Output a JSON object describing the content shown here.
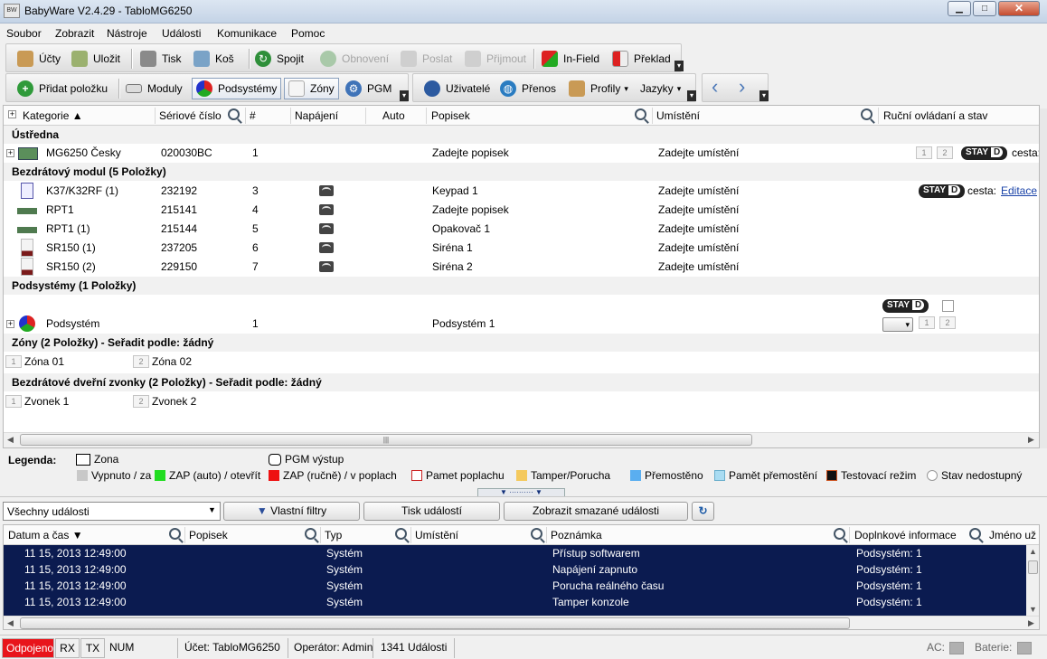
{
  "window": {
    "title": "BabyWare V2.4.29 - TabloMG6250",
    "app_icon_text": "BW",
    "minimize": "▁",
    "maximize": "□",
    "close": "✕"
  },
  "menu": [
    "Soubor",
    "Zobrazit",
    "Nástroje",
    "Události",
    "Komunikace",
    "Pomoc"
  ],
  "toolbar1": {
    "accounts": "Účty",
    "save": "Uložit",
    "print": "Tisk",
    "trash": "Koš",
    "connect": "Spojit",
    "refresh": "Obnovení",
    "send": "Poslat",
    "receive": "Přijmout",
    "infield": "In-Field",
    "translate": "Překlad"
  },
  "toolbar2": {
    "add_item": "Přidat položku",
    "modules": "Moduly",
    "subsystems": "Podsystémy",
    "zones": "Zóny",
    "pgm": "PGM",
    "users": "Uživatelé",
    "transfer": "Přenos",
    "profiles": "Profily",
    "languages": "Jazyky"
  },
  "grid": {
    "headers": {
      "category": "Kategorie",
      "serial": "Sériové číslo",
      "num": "#",
      "power": "Napájení",
      "auto": "Auto",
      "label": "Popisek",
      "location": "Umístění",
      "manual": "Ruční ovládaní a stav"
    },
    "groups": {
      "panel": "Ústředna",
      "wireless": "Bezdrátový modul (5 Položky)",
      "subsystems": "Podsystémy (1 Položky)",
      "zones": "Zóny  (2 Položky) - Seřadit podle: žádný",
      "doorbells": "Bezdrátové dveřní zvonky (2 Položky) - Seřadit podle: žádný"
    },
    "panel_row": {
      "name": "MG6250 Česky",
      "serial": "020030BC",
      "num": "1",
      "label": "Zadejte popisek",
      "location": "Zadejte umístění",
      "box1": "1",
      "box2": "2",
      "stay": "STAY",
      "stay_d": "D",
      "path": "cesta:"
    },
    "modules": [
      {
        "name": "K37/K32RF (1)",
        "serial": "232192",
        "num": "3",
        "label": "Keypad 1",
        "location": "Zadejte umístění"
      },
      {
        "name": "RPT1",
        "serial": "215141",
        "num": "4",
        "label": "Zadejte popisek",
        "location": "Zadejte umístění"
      },
      {
        "name": "RPT1 (1)",
        "serial": "215144",
        "num": "5",
        "label": "Opakovač 1",
        "location": "Zadejte umístění"
      },
      {
        "name": "SR150 (1)",
        "serial": "237205",
        "num": "6",
        "label": "Siréna 1",
        "location": "Zadejte umístění"
      },
      {
        "name": "SR150 (2)",
        "serial": "229150",
        "num": "7",
        "label": "Siréna 2",
        "location": "Zadejte umístění"
      }
    ],
    "keypad_extra": {
      "stay": "STAY",
      "stay_d": "D",
      "path": "cesta:",
      "edit": "Editace"
    },
    "subsystem_row": {
      "name": "Podsystém",
      "num": "1",
      "label": "Podsystém 1",
      "stay": "STAY",
      "stay_d": "D",
      "box1": "1",
      "box2": "2"
    },
    "zones": [
      {
        "num": "1",
        "name": "Zóna 01"
      },
      {
        "num": "2",
        "name": "Zóna 02"
      }
    ],
    "doorbells": [
      {
        "num": "1",
        "name": "Zvonek 1"
      },
      {
        "num": "2",
        "name": "Zvonek 2"
      }
    ],
    "hscroll_grip": "|||"
  },
  "legend": {
    "title": "Legenda:",
    "zone": "Zona",
    "pgm": "PGM výstup",
    "items": [
      {
        "label": "Vypnuto / za",
        "color": "#c8c8c8"
      },
      {
        "label": "ZAP (auto) / otevřít",
        "color": "#22dd22"
      },
      {
        "label": "ZAP (ručně) / v poplach",
        "color": "#ee1111"
      },
      {
        "label": "Pamet poplachu",
        "color": "#ffffff",
        "border": "#cc2222"
      },
      {
        "label": "Tamper/Porucha",
        "color": "#f4c95d"
      },
      {
        "label": "Přemostěno",
        "color": "#5aaef0"
      },
      {
        "label": "Pamět přemostění",
        "color": "#a9dcf2",
        "border": "#6aaecc"
      },
      {
        "label": "Testovací režim",
        "color": "#111111",
        "border": "#cc5522"
      },
      {
        "label": "Stav nedostupný",
        "color": "#ffffff",
        "border": "#999999"
      }
    ]
  },
  "events": {
    "filter_value": "Všechny události",
    "custom_filters": "Vlastní filtry",
    "print_events": "Tisk událostí",
    "show_deleted": "Zobrazit smazané události",
    "refresh_icon": "↻",
    "headers": {
      "datetime": "Datum a čas",
      "label": "Popisek",
      "type": "Typ",
      "location": "Umístění",
      "note": "Poznámka",
      "extra": "Doplnkové informace",
      "user": "Jméno už"
    },
    "rows": [
      {
        "datetime": "11 15, 2013  12:49:00",
        "type": "Systém",
        "note": "Přístup softwarem",
        "extra": "Podsystém: 1"
      },
      {
        "datetime": "11 15, 2013  12:49:00",
        "type": "Systém",
        "note": "Napájení zapnuto",
        "extra": "Podsystém: 1"
      },
      {
        "datetime": "11 15, 2013  12:49:00",
        "type": "Systém",
        "note": "Porucha reálného času",
        "extra": "Podsystém: 1"
      },
      {
        "datetime": "11 15, 2013  12:49:00",
        "type": "Systém",
        "note": "Tamper konzole",
        "extra": "Podsystém: 1"
      }
    ]
  },
  "status": {
    "disconnected": "Odpojeno",
    "rx": "RX",
    "tx": "TX",
    "num": "NUM",
    "account": "Účet: TabloMG6250",
    "operator": "Operátor: Admin",
    "events_count": "1341 Události",
    "ac": "AC:",
    "battery": "Baterie:",
    "disconnected_color": "#e8141b"
  }
}
